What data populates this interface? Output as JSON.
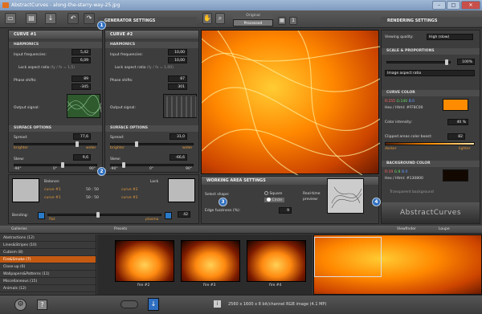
{
  "window": {
    "title": "AbstractCurves - along-the-starry-way-25.jpg"
  },
  "toolbar": {
    "icons": [
      "new-icon",
      "open-icon",
      "save-icon",
      "undo-icon",
      "redo-icon"
    ],
    "generator_label": "GENERATOR SETTINGS",
    "view_tabs": [
      "Original",
      "Processed"
    ],
    "rendering_label": "RENDERING SETTINGS"
  },
  "curve1": {
    "title": "CURVE #1",
    "harmonics": "HARMONICS",
    "input_freq_label": "Input frequencies:",
    "fx": "5,42",
    "fy": "6,09",
    "lock_aspect": "Lock aspect ratio",
    "lock_hint": "(fy / fx = 1,5)",
    "phase_label": "Phase shifts:",
    "px": "89",
    "py": "-345",
    "px_unit": "°",
    "output_label": "Output signal:"
  },
  "curve2": {
    "title": "CURVE #2",
    "harmonics": "HARMONICS",
    "input_freq_label": "Input frequencies:",
    "fx": "10,00",
    "fy": "10,00",
    "lock_aspect": "Lock aspect ratio",
    "lock_hint": "(fy / fx = 1,00)",
    "phase_label": "Phase shifts:",
    "px": "87",
    "py": "301",
    "output_label": "Output signal:"
  },
  "surface1": {
    "title": "SURFACE OPTIONS",
    "spread_label": "Spread:",
    "spread": "77,6",
    "brighter": "brighter",
    "wider": "wider",
    "skew_label": "Skew:",
    "skew": "9,6",
    "skew_min": "-90°",
    "skew_zero": "0°",
    "skew_max": "90°"
  },
  "surface2": {
    "title": "SURFACE OPTIONS",
    "spread_label": "Spread:",
    "spread": "31,0",
    "brighter": "brighter",
    "wider": "wider",
    "skew_label": "Skew:",
    "skew": "-66,6",
    "skew_min": "-90°",
    "skew_zero": "0°",
    "skew_max": "90°"
  },
  "balance": {
    "label": "Balance:",
    "curve1": "curve #1",
    "curve2": "curve #2",
    "lock": "Lock",
    "r1": "50 : 50",
    "r2": "50 : 50",
    "bending_label": "Bending:",
    "flat": "flat",
    "plasma": "plasma",
    "bending": "42"
  },
  "working": {
    "title": "WORKING AREA SETTINGS",
    "shape_label": "Select shape:",
    "square": "Square",
    "circle": "Circle",
    "edge_label": "Edge fuzziness (%):",
    "edge": "9",
    "preview_label": "Real-time preview:"
  },
  "rendering": {
    "viewing_quality_label": "Viewing quality:",
    "viewing_quality": "High (slow)",
    "scale_title": "SCALE & PROPORTIONS",
    "scale_pct": "100%",
    "aspect": "Image aspect ratio",
    "curve_color_title": "CURVE COLOR",
    "curve_r": "R:255",
    "curve_g": "G:140",
    "curve_b": "B:0",
    "hex_label": "Hex / Html:",
    "curve_hex": "#FF8C00",
    "intensity_label": "Color intensity:",
    "intensity": "40 %",
    "clipped_label": "Clipped areas color boost:",
    "clipped": "82",
    "darker": "darker",
    "lighter": "lighter",
    "bg_color_title": "BACKGROUND COLOR",
    "bg_r": "R:19",
    "bg_g": "G:8",
    "bg_b": "B:0",
    "bg_hex": "#130800",
    "transparent": "Transparent background",
    "logo": "AbstractCurves",
    "curve_color_hex": "#FF8C00",
    "bg_color_hex": "#130800"
  },
  "galleries": {
    "tab_galleries": "Galleries",
    "presets": "Presets",
    "viewfinder": "Viewfinder",
    "loupe": "Loupe",
    "categories": [
      "Abstractions (12)",
      "Lines&Stripes (10)",
      "Cubism (8)",
      "Fire&Smoke (7)",
      "Close-up (6)",
      "Wallpapers&Patterns (11)",
      "Miscellaneous (15)",
      "Animals (12)"
    ],
    "selected": 3,
    "items": [
      "fire #2",
      "fire #3",
      "fire #4"
    ]
  },
  "badges": [
    "1",
    "2",
    "3",
    "4"
  ],
  "status": {
    "text": "2560 x 1600 x 8 bit/channel RGB image  (4.1 MP)"
  }
}
